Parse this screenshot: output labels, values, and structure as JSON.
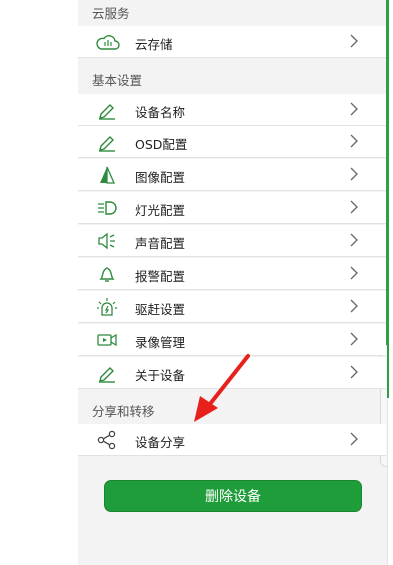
{
  "sections": {
    "cloud": {
      "title": "云服务",
      "items": [
        {
          "label": "云存储",
          "icon": "cloud-icon"
        }
      ]
    },
    "basic": {
      "title": "基本设置",
      "items": [
        {
          "label": "设备名称",
          "icon": "pencil-icon"
        },
        {
          "label": "OSD配置",
          "icon": "pencil-icon"
        },
        {
          "label": "图像配置",
          "icon": "image-prism-icon"
        },
        {
          "label": "灯光配置",
          "icon": "light-icon"
        },
        {
          "label": "声音配置",
          "icon": "speaker-icon"
        },
        {
          "label": "报警配置",
          "icon": "bell-icon"
        },
        {
          "label": "驱赶设置",
          "icon": "siren-icon"
        },
        {
          "label": "录像管理",
          "icon": "video-record-icon"
        },
        {
          "label": "关于设备",
          "icon": "pencil-icon"
        }
      ]
    },
    "share": {
      "title": "分享和转移",
      "items": [
        {
          "label": "设备分享",
          "icon": "share-icon"
        }
      ]
    }
  },
  "delete_button": {
    "label": "删除设备"
  },
  "colors": {
    "accent": "#1f9d3a",
    "arrow": "#e8201c",
    "icon": "#2e8b3e"
  }
}
